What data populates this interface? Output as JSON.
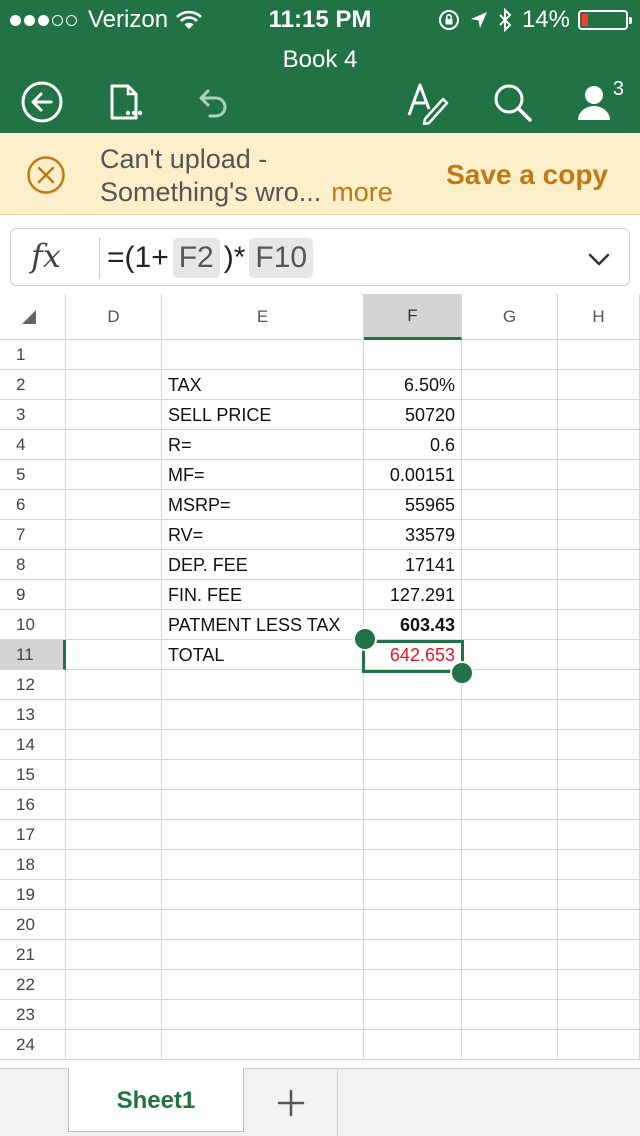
{
  "status_bar": {
    "carrier": "Verizon",
    "time": "11:15 PM",
    "battery": "14%",
    "battery_level": 0.14
  },
  "document": {
    "title": "Book 4"
  },
  "toolbar": {
    "user_count": "3"
  },
  "warning": {
    "line1": "Can't upload -",
    "line2": "Something's wro...",
    "more": "more",
    "action": "Save a copy"
  },
  "formula_bar": {
    "fx": "fx",
    "prefix": "=(1+",
    "ref1": "F2",
    "middle": ")*",
    "ref2": "F10"
  },
  "columns": [
    "D",
    "E",
    "F",
    "G",
    "H"
  ],
  "rows": [
    {
      "n": "1",
      "label": "",
      "value": ""
    },
    {
      "n": "2",
      "label": "TAX",
      "value": "6.50%"
    },
    {
      "n": "3",
      "label": "SELL PRICE",
      "value": "50720"
    },
    {
      "n": "4",
      "label": "R=",
      "value": "0.6"
    },
    {
      "n": "5",
      "label": "MF=",
      "value": "0.00151"
    },
    {
      "n": "6",
      "label": "MSRP=",
      "value": "55965"
    },
    {
      "n": "7",
      "label": "RV=",
      "value": "33579"
    },
    {
      "n": "8",
      "label": "DEP. FEE",
      "value": "17141"
    },
    {
      "n": "9",
      "label": "FIN. FEE",
      "value": "127.291"
    },
    {
      "n": "10",
      "label": "PATMENT LESS TAX",
      "value": "603.43"
    },
    {
      "n": "11",
      "label": "TOTAL",
      "value": "642.653"
    },
    {
      "n": "12",
      "label": "",
      "value": ""
    },
    {
      "n": "13",
      "label": "",
      "value": ""
    },
    {
      "n": "14",
      "label": "",
      "value": ""
    },
    {
      "n": "15",
      "label": "",
      "value": ""
    },
    {
      "n": "16",
      "label": "",
      "value": ""
    },
    {
      "n": "17",
      "label": "",
      "value": ""
    },
    {
      "n": "18",
      "label": "",
      "value": ""
    },
    {
      "n": "19",
      "label": "",
      "value": ""
    },
    {
      "n": "20",
      "label": "",
      "value": ""
    },
    {
      "n": "21",
      "label": "",
      "value": ""
    },
    {
      "n": "22",
      "label": "",
      "value": ""
    },
    {
      "n": "23",
      "label": "",
      "value": ""
    },
    {
      "n": "24",
      "label": "",
      "value": ""
    }
  ],
  "sheet_tabs": {
    "active": "Sheet1",
    "add": "+"
  },
  "colors": {
    "accent": "#217346",
    "warning_bg": "#fcefc9",
    "warning_text": "#bf7a14",
    "total_red": "#e8161c"
  }
}
